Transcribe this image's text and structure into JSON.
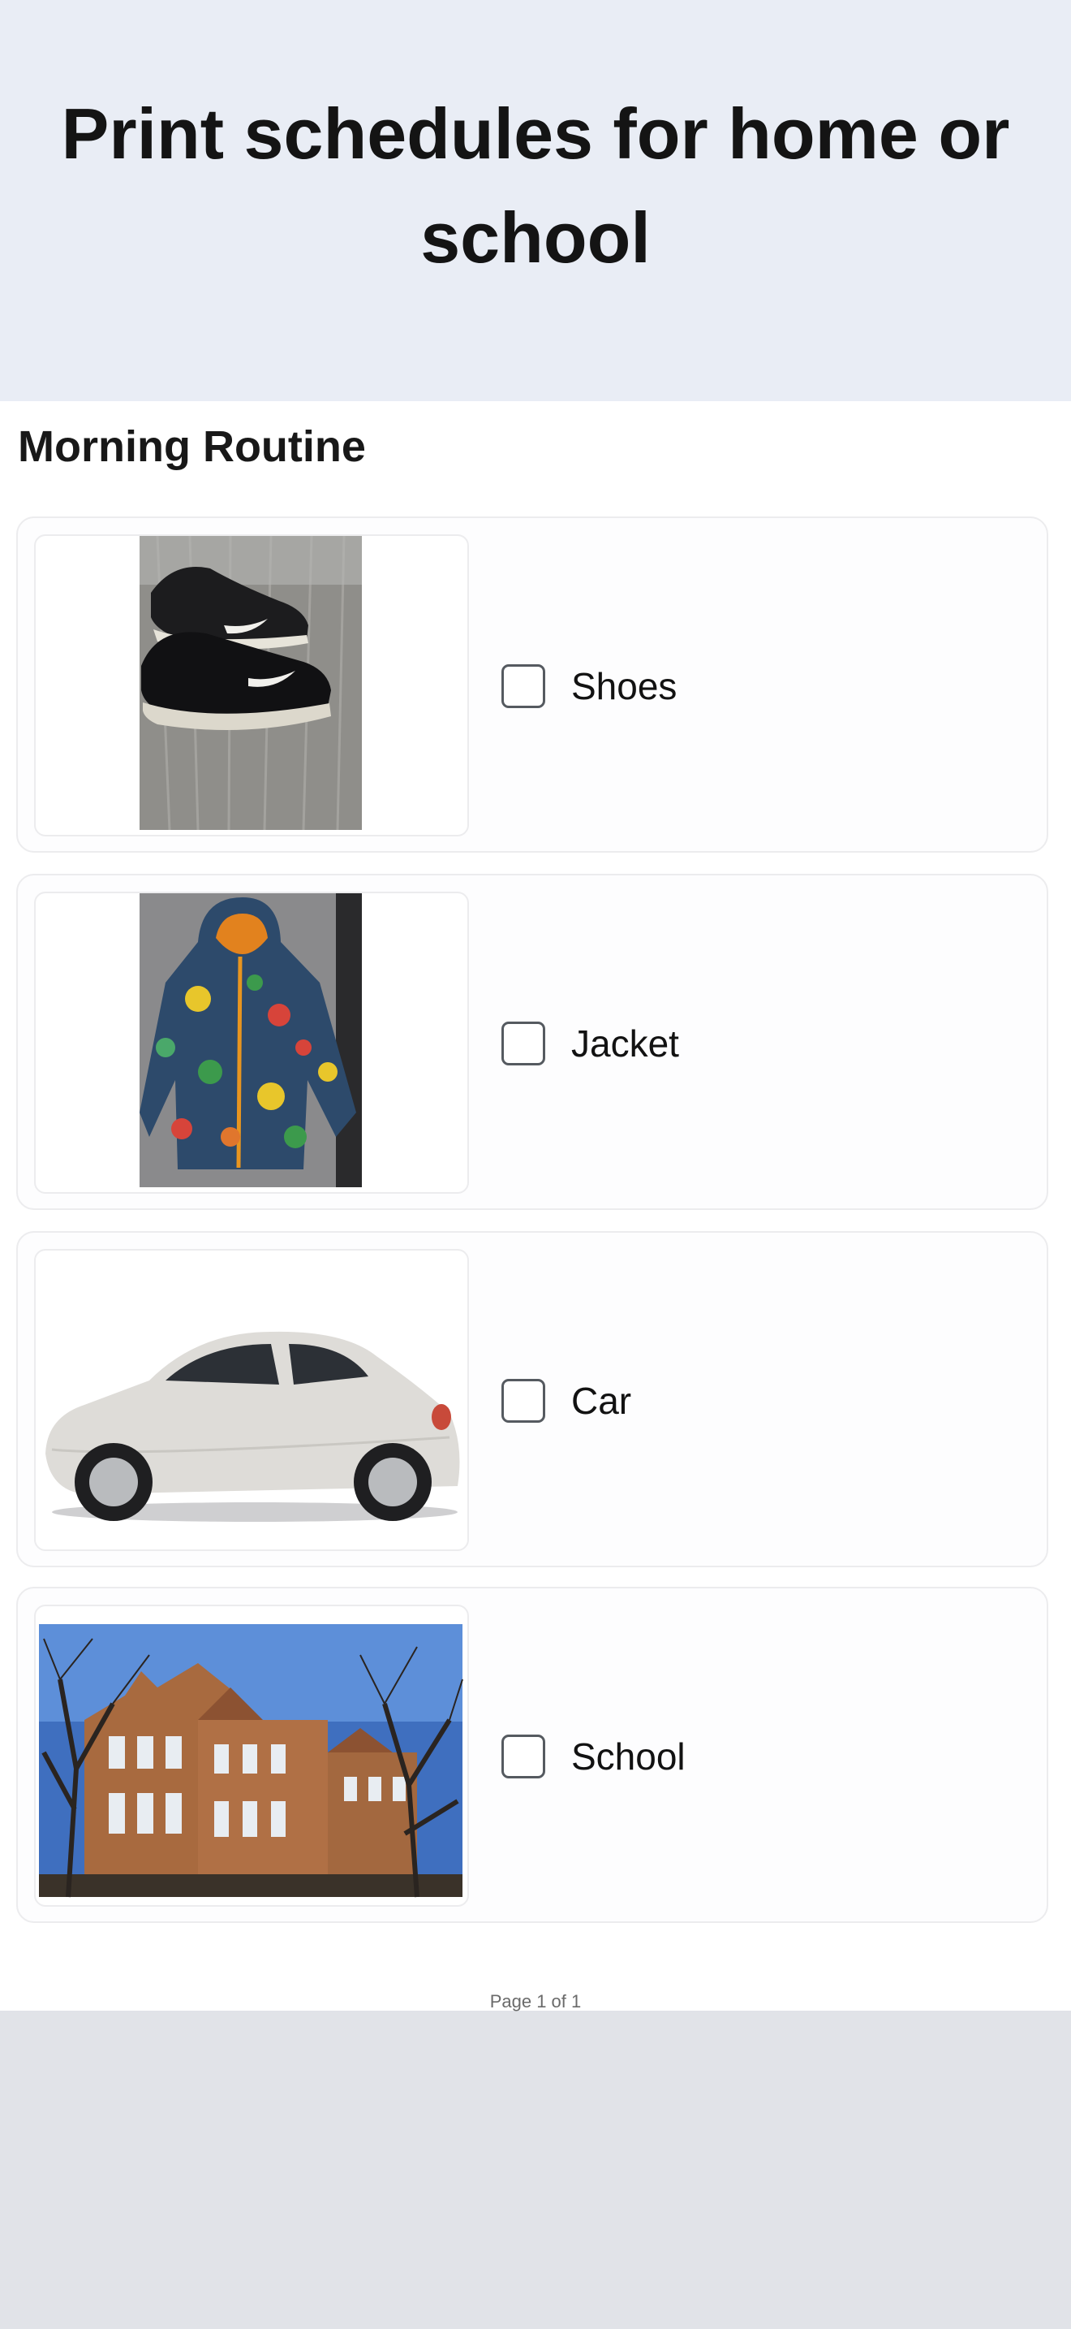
{
  "hero": {
    "title": "Print schedules for home or school"
  },
  "schedule": {
    "title": "Morning Routine",
    "items": [
      {
        "label": "Shoes",
        "image": "sneakers-photo",
        "checked": false
      },
      {
        "label": "Jacket",
        "image": "floral-jacket-photo",
        "checked": false
      },
      {
        "label": "Car",
        "image": "white-car-photo",
        "checked": false
      },
      {
        "label": "School",
        "image": "school-building-photo",
        "checked": false
      }
    ],
    "page_indicator": "Page 1 of 1"
  },
  "colors": {
    "hero_bg": "#e9edf5",
    "sheet_bg": "#ffffff",
    "outer_bg": "#e1e3e8",
    "card_border": "#ececee"
  }
}
